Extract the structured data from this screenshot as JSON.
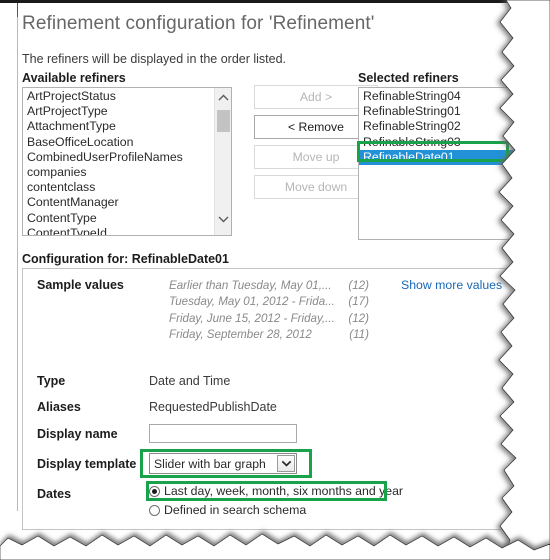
{
  "page": {
    "title": "Refinement configuration for 'Refinement'",
    "subtitle": "The refiners will be displayed in the order listed."
  },
  "available_refiners": {
    "label": "Available refiners",
    "items": [
      "ArtProjectStatus",
      "ArtProjectType",
      "AttachmentType",
      "BaseOfficeLocation",
      "CombinedUserProfileNames",
      "companies",
      "contentclass",
      "ContentManager",
      "ContentType",
      "ContentTypeId"
    ]
  },
  "selected_refiners": {
    "label": "Selected refiners",
    "items": [
      {
        "label": "RefinableString04",
        "selected": false
      },
      {
        "label": "RefinableString01",
        "selected": false
      },
      {
        "label": "RefinableString02",
        "selected": false
      },
      {
        "label": "RefinableString03",
        "selected": false
      },
      {
        "label": "RefinableDate01",
        "selected": true
      }
    ]
  },
  "buttons": {
    "add": "Add >",
    "remove": "< Remove",
    "move_up": "Move up",
    "move_down": "Move down"
  },
  "configuration": {
    "heading": "Configuration for: RefinableDate01",
    "sample_values_label": "Sample values",
    "sample_values": [
      {
        "text": "Earlier than Tuesday, May 01,...",
        "count": "(12)"
      },
      {
        "text": "Tuesday, May 01, 2012 - Frida...",
        "count": "(17)"
      },
      {
        "text": "Friday, June 15, 2012 - Friday,...",
        "count": "(12)"
      },
      {
        "text": "Friday, September 28, 2012",
        "count": "(11)"
      }
    ],
    "show_more_values": "Show more values",
    "type_label": "Type",
    "type_value": "Date and Time",
    "aliases_label": "Aliases",
    "aliases_value": "RequestedPublishDate",
    "display_name_label": "Display name",
    "display_name_value": "",
    "display_template_label": "Display template",
    "display_template_value": "Slider with bar graph",
    "dates_label": "Dates",
    "dates_options": [
      {
        "label": "Last day, week, month, six months and year",
        "checked": true
      },
      {
        "label": "Defined in search schema",
        "checked": false
      }
    ]
  },
  "colors": {
    "annotation_green": "#18a34a",
    "selection_blue": "#2291d8",
    "link_blue": "#1868b7",
    "title_gray": "#676767"
  }
}
